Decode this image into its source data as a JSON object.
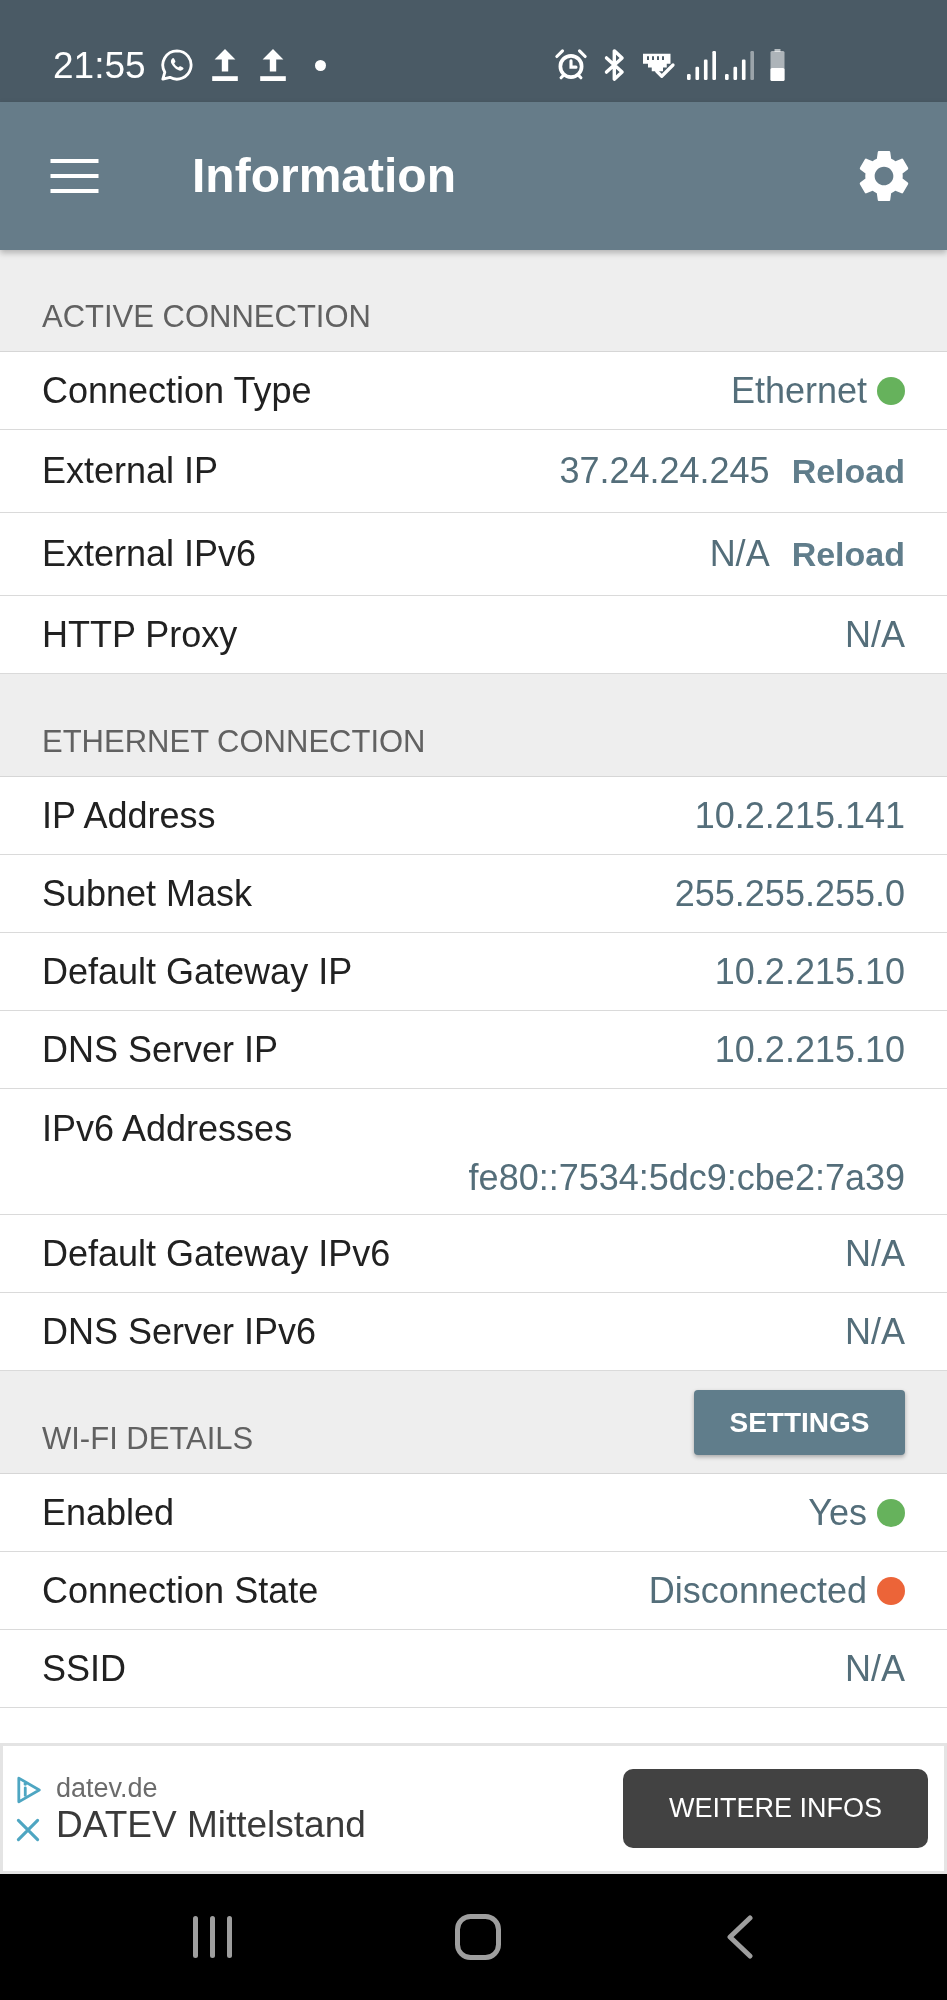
{
  "status_bar": {
    "time": "21:55"
  },
  "app_bar": {
    "title": "Information"
  },
  "sections": [
    {
      "title": "ACTIVE CONNECTION",
      "rows": [
        {
          "kind": "status",
          "label": "Connection Type",
          "value": "Ethernet",
          "color": "#66b25c"
        },
        {
          "kind": "action",
          "label": "External IP",
          "value": "37.24.24.245",
          "action": "Reload"
        },
        {
          "kind": "action",
          "label": "External IPv6",
          "value": "N/A",
          "action": "Reload"
        },
        {
          "kind": "text",
          "label": "HTTP Proxy",
          "value": "N/A"
        }
      ]
    },
    {
      "title": "ETHERNET CONNECTION",
      "rows": [
        {
          "kind": "text",
          "label": "IP Address",
          "value": "10.2.215.141"
        },
        {
          "kind": "text",
          "label": "Subnet Mask",
          "value": "255.255.255.0"
        },
        {
          "kind": "text",
          "label": "Default Gateway IP",
          "value": "10.2.215.10"
        },
        {
          "kind": "text",
          "label": "DNS Server IP",
          "value": "10.2.215.10"
        },
        {
          "kind": "stacked",
          "label": "IPv6 Addresses",
          "value": "fe80::7534:5dc9:cbe2:7a39"
        },
        {
          "kind": "text",
          "label": "Default Gateway IPv6",
          "value": "N/A"
        },
        {
          "kind": "text",
          "label": "DNS Server IPv6",
          "value": "N/A"
        }
      ]
    },
    {
      "title": "WI-FI DETAILS",
      "button": "SETTINGS",
      "rows": [
        {
          "kind": "status",
          "label": "Enabled",
          "value": "Yes",
          "color": "#66b25c"
        },
        {
          "kind": "status",
          "label": "Connection State",
          "value": "Disconnected",
          "color": "#ec6438"
        },
        {
          "kind": "text",
          "label": "SSID",
          "value": "N/A"
        }
      ]
    }
  ],
  "ad": {
    "domain": "datev.de",
    "title": "DATEV Mittelstand",
    "button": "WEITERE INFOS"
  }
}
